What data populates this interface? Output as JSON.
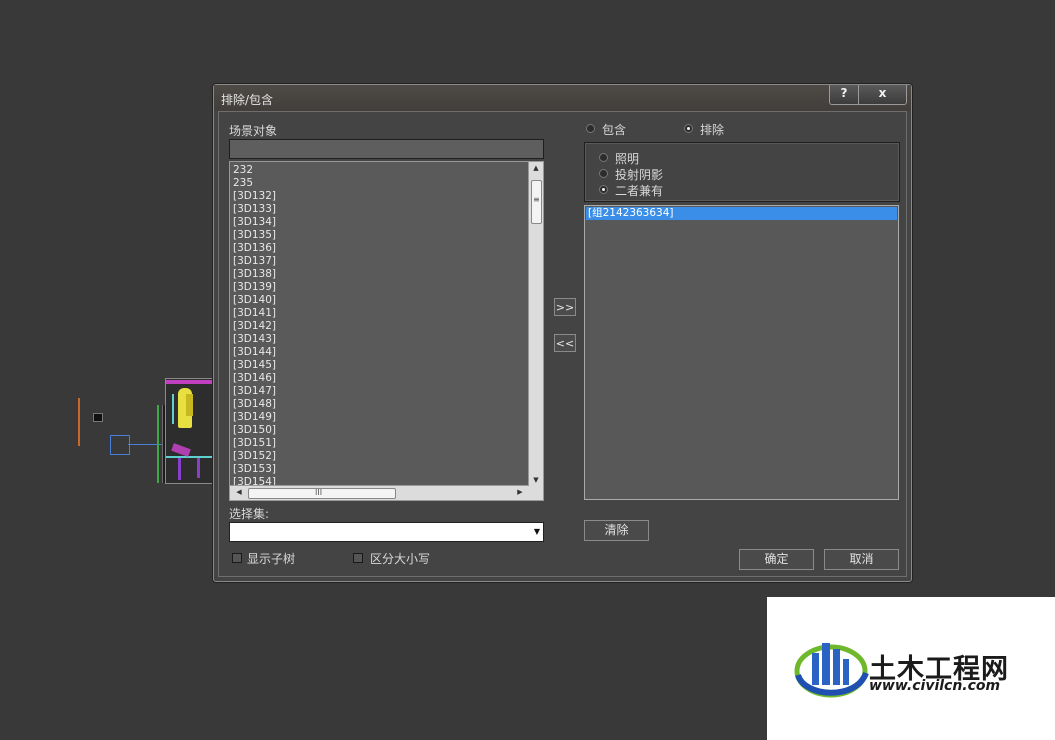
{
  "dialog": {
    "title": "排除/包含",
    "help_label": "?",
    "close_label": "x",
    "scene_objects_label": "场景对象",
    "scene_filter_value": "",
    "scene_objects": [
      "232",
      "235",
      "[3D132]",
      "[3D133]",
      "[3D134]",
      "[3D135]",
      "[3D136]",
      "[3D137]",
      "[3D138]",
      "[3D139]",
      "[3D140]",
      "[3D141]",
      "[3D142]",
      "[3D143]",
      "[3D144]",
      "[3D145]",
      "[3D146]",
      "[3D147]",
      "[3D148]",
      "[3D149]",
      "[3D150]",
      "[3D151]",
      "[3D152]",
      "[3D153]",
      "[3D154]"
    ],
    "add_button": ">>",
    "remove_button": "<<",
    "mode": {
      "include_label": "包含",
      "exclude_label": "排除",
      "selected": "exclude"
    },
    "effect": {
      "illumination_label": "照明",
      "shadow_label": "投射阴影",
      "both_label": "二者兼有",
      "selected": "both"
    },
    "excluded_items": [
      "[组2142363634]"
    ],
    "selection_set_label": "选择集:",
    "selection_set_value": "",
    "clear_button": "清除",
    "show_subtree_label": "显示子树",
    "show_subtree_checked": false,
    "case_sensitive_label": "区分大小写",
    "case_sensitive_checked": false,
    "ok_button": "确定",
    "cancel_button": "取消"
  },
  "scrollbar": {
    "up": "▲",
    "down": "▼",
    "left": "◀",
    "right": "▶",
    "grip_v": "≡",
    "grip_h": "III"
  },
  "watermark": {
    "title": "土木工程网",
    "url": "www.civilcn.com"
  },
  "colors": {
    "selection": "#3a8ee8",
    "dialog_bg": "#444444",
    "viewport_bg": "#393939"
  }
}
